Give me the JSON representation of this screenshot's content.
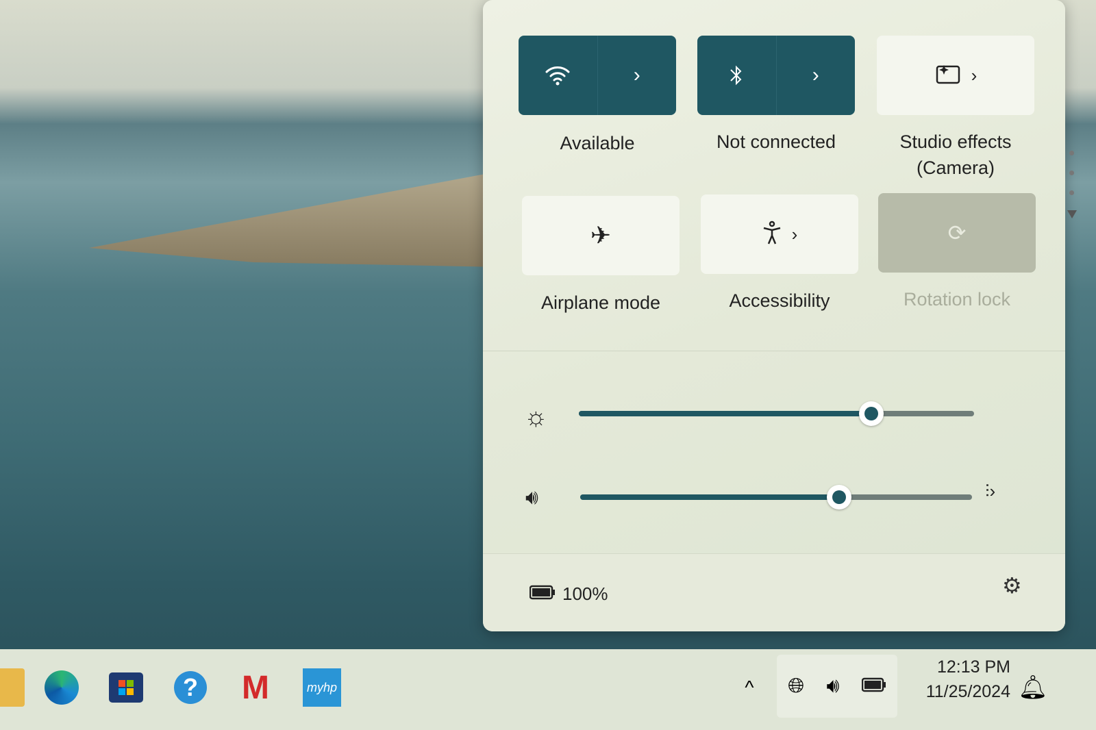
{
  "quick_settings": {
    "tiles": [
      {
        "label": "Available",
        "icon": "wifi-icon",
        "state": "on",
        "has_chevron": true
      },
      {
        "label": "Not connected",
        "icon": "bluetooth-icon",
        "state": "on",
        "has_chevron": true
      },
      {
        "label": "Studio effects",
        "label2": "(Camera)",
        "icon": "studio-effects-icon",
        "state": "off",
        "has_chevron": true
      },
      {
        "label": "Airplane mode",
        "icon": "airplane-icon",
        "state": "off",
        "has_chevron": false
      },
      {
        "label": "Accessibility",
        "icon": "accessibility-icon",
        "state": "off",
        "has_chevron": true
      },
      {
        "label": "Rotation lock",
        "icon": "rotation-lock-icon",
        "state": "disabled",
        "has_chevron": false
      }
    ],
    "brightness_percent": 74,
    "volume_percent": 66,
    "battery": "100%",
    "accent_color": "#1f5762"
  },
  "taskbar": {
    "apps": [
      "file-explorer-icon",
      "edge-icon",
      "microsoft-store-icon",
      "help-icon",
      "mcafee-icon",
      "myhp-icon"
    ],
    "myhp_label": "myhp",
    "time": "12:13 PM",
    "date": "11/25/2024"
  }
}
